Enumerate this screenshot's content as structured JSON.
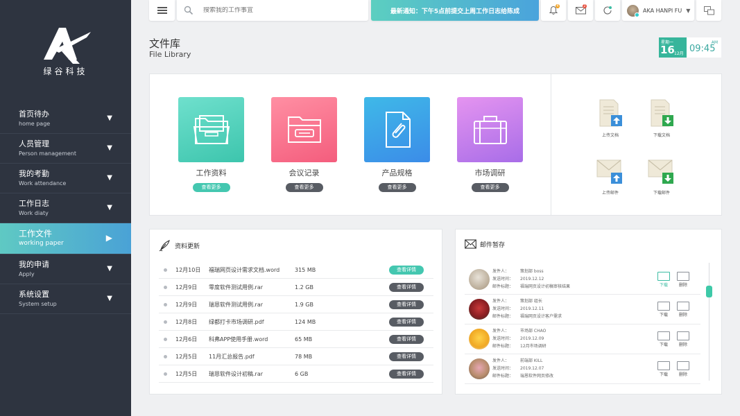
{
  "brand": {
    "name": "绿谷科技"
  },
  "sidebar": {
    "items": [
      {
        "zh": "首页待办",
        "en": "home page",
        "arrow": "▼"
      },
      {
        "zh": "人员管理",
        "en": "Person management",
        "arrow": "▼"
      },
      {
        "zh": "我的考勤",
        "en": "Work attendance",
        "arrow": "▼"
      },
      {
        "zh": "工作日志",
        "en": "Work diaty",
        "arrow": "▼"
      },
      {
        "zh": "工作文件",
        "en": "working paper",
        "arrow": "▶"
      },
      {
        "zh": "我的申请",
        "en": "Apply",
        "arrow": "▼"
      },
      {
        "zh": "系统设置",
        "en": "System setup",
        "arrow": "▼"
      }
    ],
    "active_index": 4
  },
  "topbar": {
    "search_placeholder": "搜索我的工作事宜",
    "notice": "最新通知：下午5点前提交上周工作日志给陈成",
    "bell_badge": "4",
    "mail_badge": "2",
    "user_name": "AKA HANPI FU",
    "caret": "▼"
  },
  "page": {
    "title_zh": "文件库",
    "title_en": "File Library"
  },
  "date": {
    "weekday": "星期一",
    "day": "16",
    "month": "12月",
    "ampm": "AM",
    "time": "09:45"
  },
  "folders": [
    {
      "label": "工作资料",
      "button": "查看更多",
      "highlight": true
    },
    {
      "label": "会议记录",
      "button": "查看更多",
      "highlight": false
    },
    {
      "label": "产品规格",
      "button": "查看更多",
      "highlight": false
    },
    {
      "label": "市场调研",
      "button": "查看更多",
      "highlight": false
    }
  ],
  "actions": [
    {
      "label": "上传文档"
    },
    {
      "label": "下载文档"
    },
    {
      "label": "上传邮件"
    },
    {
      "label": "下载邮件"
    }
  ],
  "updates": {
    "title": "资料更新",
    "rows": [
      {
        "date": "12月10日",
        "name": "福瑞网页设计需求文档.word",
        "size": "315 MB",
        "button": "查看详情",
        "highlight": true
      },
      {
        "date": "12月9日",
        "name": "零度软件测试用例.rar",
        "size": "1.2 GB",
        "button": "查看详情",
        "highlight": false
      },
      {
        "date": "12月9日",
        "name": "瑞恩软件测试用例.rar",
        "size": "1.9 GB",
        "button": "查看详情",
        "highlight": false
      },
      {
        "date": "12月8日",
        "name": "绿都打卡市场调研.pdf",
        "size": "124 MB",
        "button": "查看详情",
        "highlight": false
      },
      {
        "date": "12月6日",
        "name": "科弗APP使用手册.word",
        "size": "65 MB",
        "button": "查看详情",
        "highlight": false
      },
      {
        "date": "12月5日",
        "name": "11月汇总报告.pdf",
        "size": "78 MB",
        "button": "查看详情",
        "highlight": false
      },
      {
        "date": "12月5日",
        "name": "瑞恩软件设计初稿.rar",
        "size": "6 GB",
        "button": "查看详情",
        "highlight": false
      }
    ]
  },
  "mail": {
    "title": "邮件暂存",
    "labels": {
      "sender": "发件人：",
      "time": "发送时间：",
      "subject": "邮件标题："
    },
    "download_label": "下载",
    "delete_label": "删除",
    "rows": [
      {
        "sender": "策划部 boss",
        "time": "2019.12.12",
        "subject": "福瑞网页设计初稿审核结果",
        "active": true
      },
      {
        "sender": "策划部 组长",
        "time": "2019.12.11",
        "subject": "福瑞网页设计客户需求",
        "active": false
      },
      {
        "sender": "市场部 CHAO",
        "time": "2019.12.09",
        "subject": "12月市场调研",
        "active": false
      },
      {
        "sender": "前端部 KILL",
        "time": "2019.12.07",
        "subject": "瑞恩软件网页修改",
        "active": false
      }
    ]
  },
  "colors": {
    "sidebar": "#2e3440",
    "accent": "#44c7b0",
    "dark_button": "#585c63"
  }
}
